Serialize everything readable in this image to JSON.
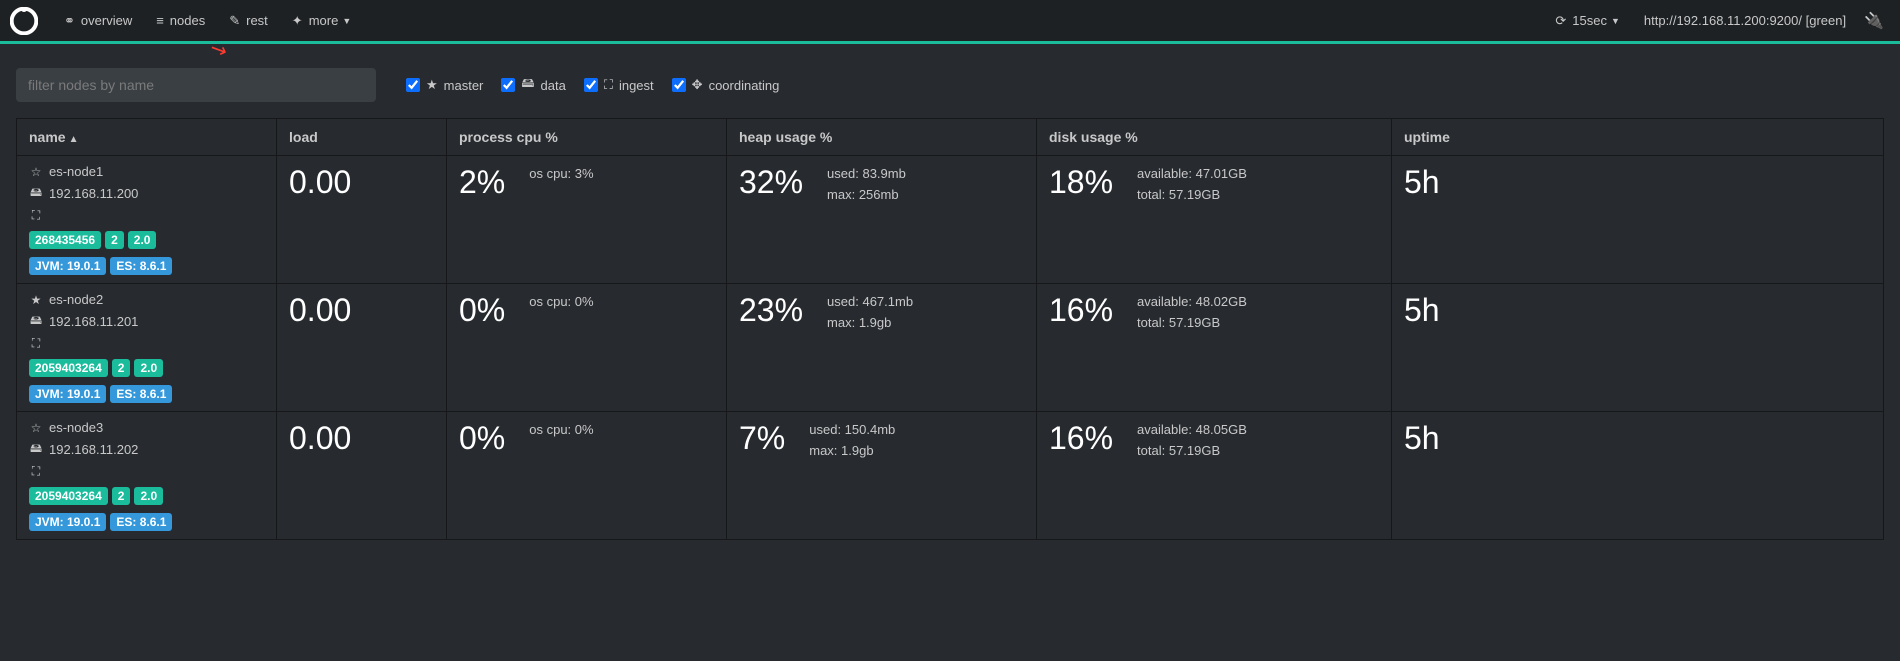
{
  "nav": {
    "overview": "overview",
    "nodes": "nodes",
    "rest": "rest",
    "more": "more"
  },
  "refresh": {
    "label": "15sec"
  },
  "host": "http://192.168.11.200:9200/ [green]",
  "filter": {
    "placeholder": "filter nodes by name"
  },
  "checks": {
    "master": "master",
    "data": "data",
    "ingest": "ingest",
    "coordinating": "coordinating"
  },
  "headers": {
    "name": "name",
    "load": "load",
    "cpu": "process cpu %",
    "heap": "heap usage %",
    "disk": "disk usage %",
    "uptime": "uptime"
  },
  "nodes": [
    {
      "name": "es-node1",
      "ip": "192.168.11.200",
      "master_icon": "☆",
      "badges_green": [
        "268435456",
        "2",
        "2.0"
      ],
      "badges_blue": [
        "JVM: 19.0.1",
        "ES: 8.6.1"
      ],
      "load": "0.00",
      "cpu": "2%",
      "os_cpu": "os cpu: 3%",
      "heap": "32%",
      "heap_used": "used: 83.9mb",
      "heap_max": "max: 256mb",
      "disk": "18%",
      "disk_avail": "available: 47.01GB",
      "disk_total": "total: 57.19GB",
      "uptime": "5h"
    },
    {
      "name": "es-node2",
      "ip": "192.168.11.201",
      "master_icon": "★",
      "badges_green": [
        "2059403264",
        "2",
        "2.0"
      ],
      "badges_blue": [
        "JVM: 19.0.1",
        "ES: 8.6.1"
      ],
      "load": "0.00",
      "cpu": "0%",
      "os_cpu": "os cpu: 0%",
      "heap": "23%",
      "heap_used": "used: 467.1mb",
      "heap_max": "max: 1.9gb",
      "disk": "16%",
      "disk_avail": "available: 48.02GB",
      "disk_total": "total: 57.19GB",
      "uptime": "5h"
    },
    {
      "name": "es-node3",
      "ip": "192.168.11.202",
      "master_icon": "☆",
      "badges_green": [
        "2059403264",
        "2",
        "2.0"
      ],
      "badges_blue": [
        "JVM: 19.0.1",
        "ES: 8.6.1"
      ],
      "load": "0.00",
      "cpu": "0%",
      "os_cpu": "os cpu: 0%",
      "heap": "7%",
      "heap_used": "used: 150.4mb",
      "heap_max": "max: 1.9gb",
      "disk": "16%",
      "disk_avail": "available: 48.05GB",
      "disk_total": "total: 57.19GB",
      "uptime": "5h"
    }
  ]
}
